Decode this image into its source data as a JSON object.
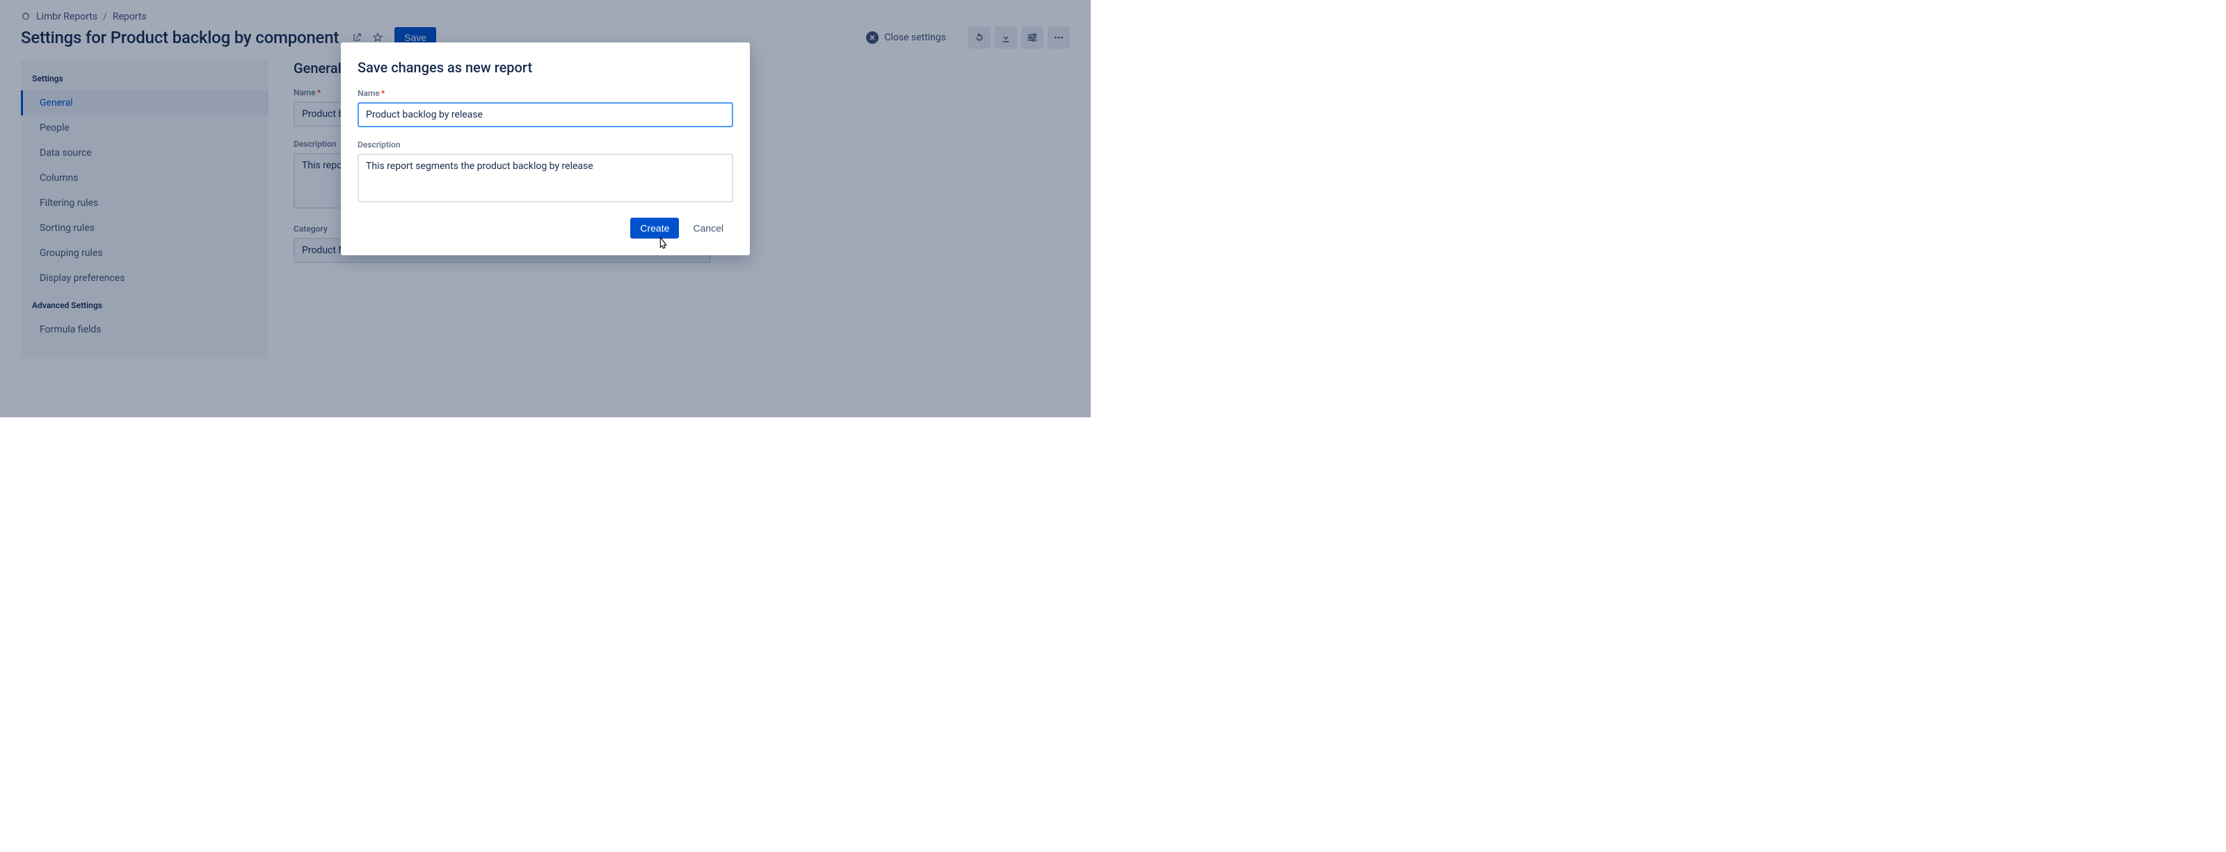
{
  "breadcrumbs": {
    "item0": "Limbr Reports",
    "item1": "Reports"
  },
  "header": {
    "title_prefix": "Settings for ",
    "title_report": "Product backlog by component",
    "save_label": "Save",
    "close_label": "Close settings"
  },
  "sidebar": {
    "heading_settings": "Settings",
    "heading_advanced": "Advanced Settings",
    "items": {
      "general": "General",
      "people": "People",
      "datasource": "Data source",
      "columns": "Columns",
      "filtering": "Filtering rules",
      "sorting": "Sorting rules",
      "grouping": "Grouping rules",
      "display": "Display preferences",
      "formula": "Formula fields"
    }
  },
  "main": {
    "heading": "General",
    "name_label": "Name",
    "name_value": "Product backlog by release",
    "description_label": "Description",
    "description_value": "This report segments the product backlog by release",
    "category_label": "Category",
    "category_value": "Product Management"
  },
  "modal": {
    "title": "Save changes as new report",
    "name_label": "Name",
    "name_value": "Product backlog by release",
    "description_label": "Description",
    "description_value": "This report segments the product backlog by release",
    "create_label": "Create",
    "cancel_label": "Cancel"
  }
}
